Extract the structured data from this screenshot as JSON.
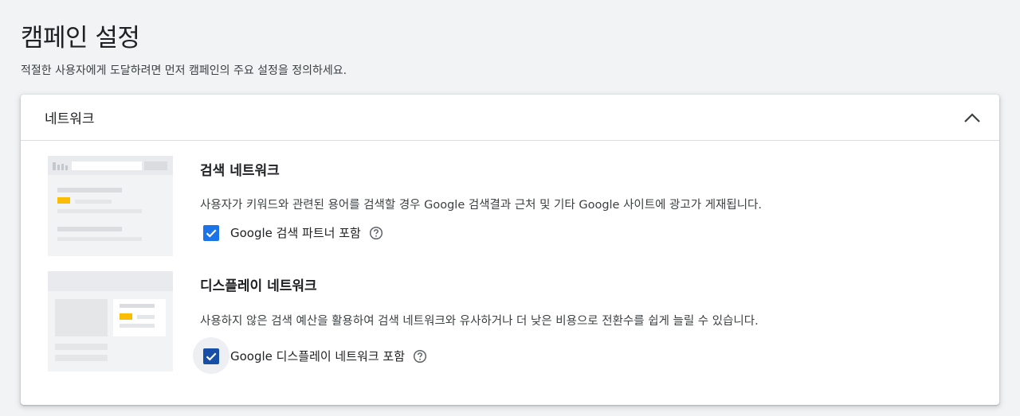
{
  "page": {
    "title": "캠페인 설정",
    "subtitle": "적절한 사용자에게 도달하려면 먼저 캠페인의 주요 설정을 정의하세요."
  },
  "network_card": {
    "title": "네트워크",
    "collapse_icon": "chevron-up-icon",
    "search": {
      "title": "검색 네트워크",
      "description": "사용자가 키워드와 관련된 용어를 검색할 경우 Google 검색결과 근처 및 기타 Google 사이트에 광고가 게재됩니다.",
      "checkbox_label": "Google 검색 파트너 포함",
      "checked": true,
      "help_icon": "help-circle-icon"
    },
    "display": {
      "title": "디스플레이 네트워크",
      "description": "사용하지 않은 검색 예산을 활용하여 검색 네트워크와 유사하거나 더 낮은 비용으로 전환수를 쉽게 늘릴 수 있습니다.",
      "checkbox_label": "Google 디스플레이 네트워크 포함",
      "checked": true,
      "help_icon": "help-circle-icon"
    }
  },
  "colors": {
    "checkbox_blue": "#1a73e8",
    "checkbox_focused": "#174ea6",
    "illustration_accent": "#fbbc04"
  }
}
